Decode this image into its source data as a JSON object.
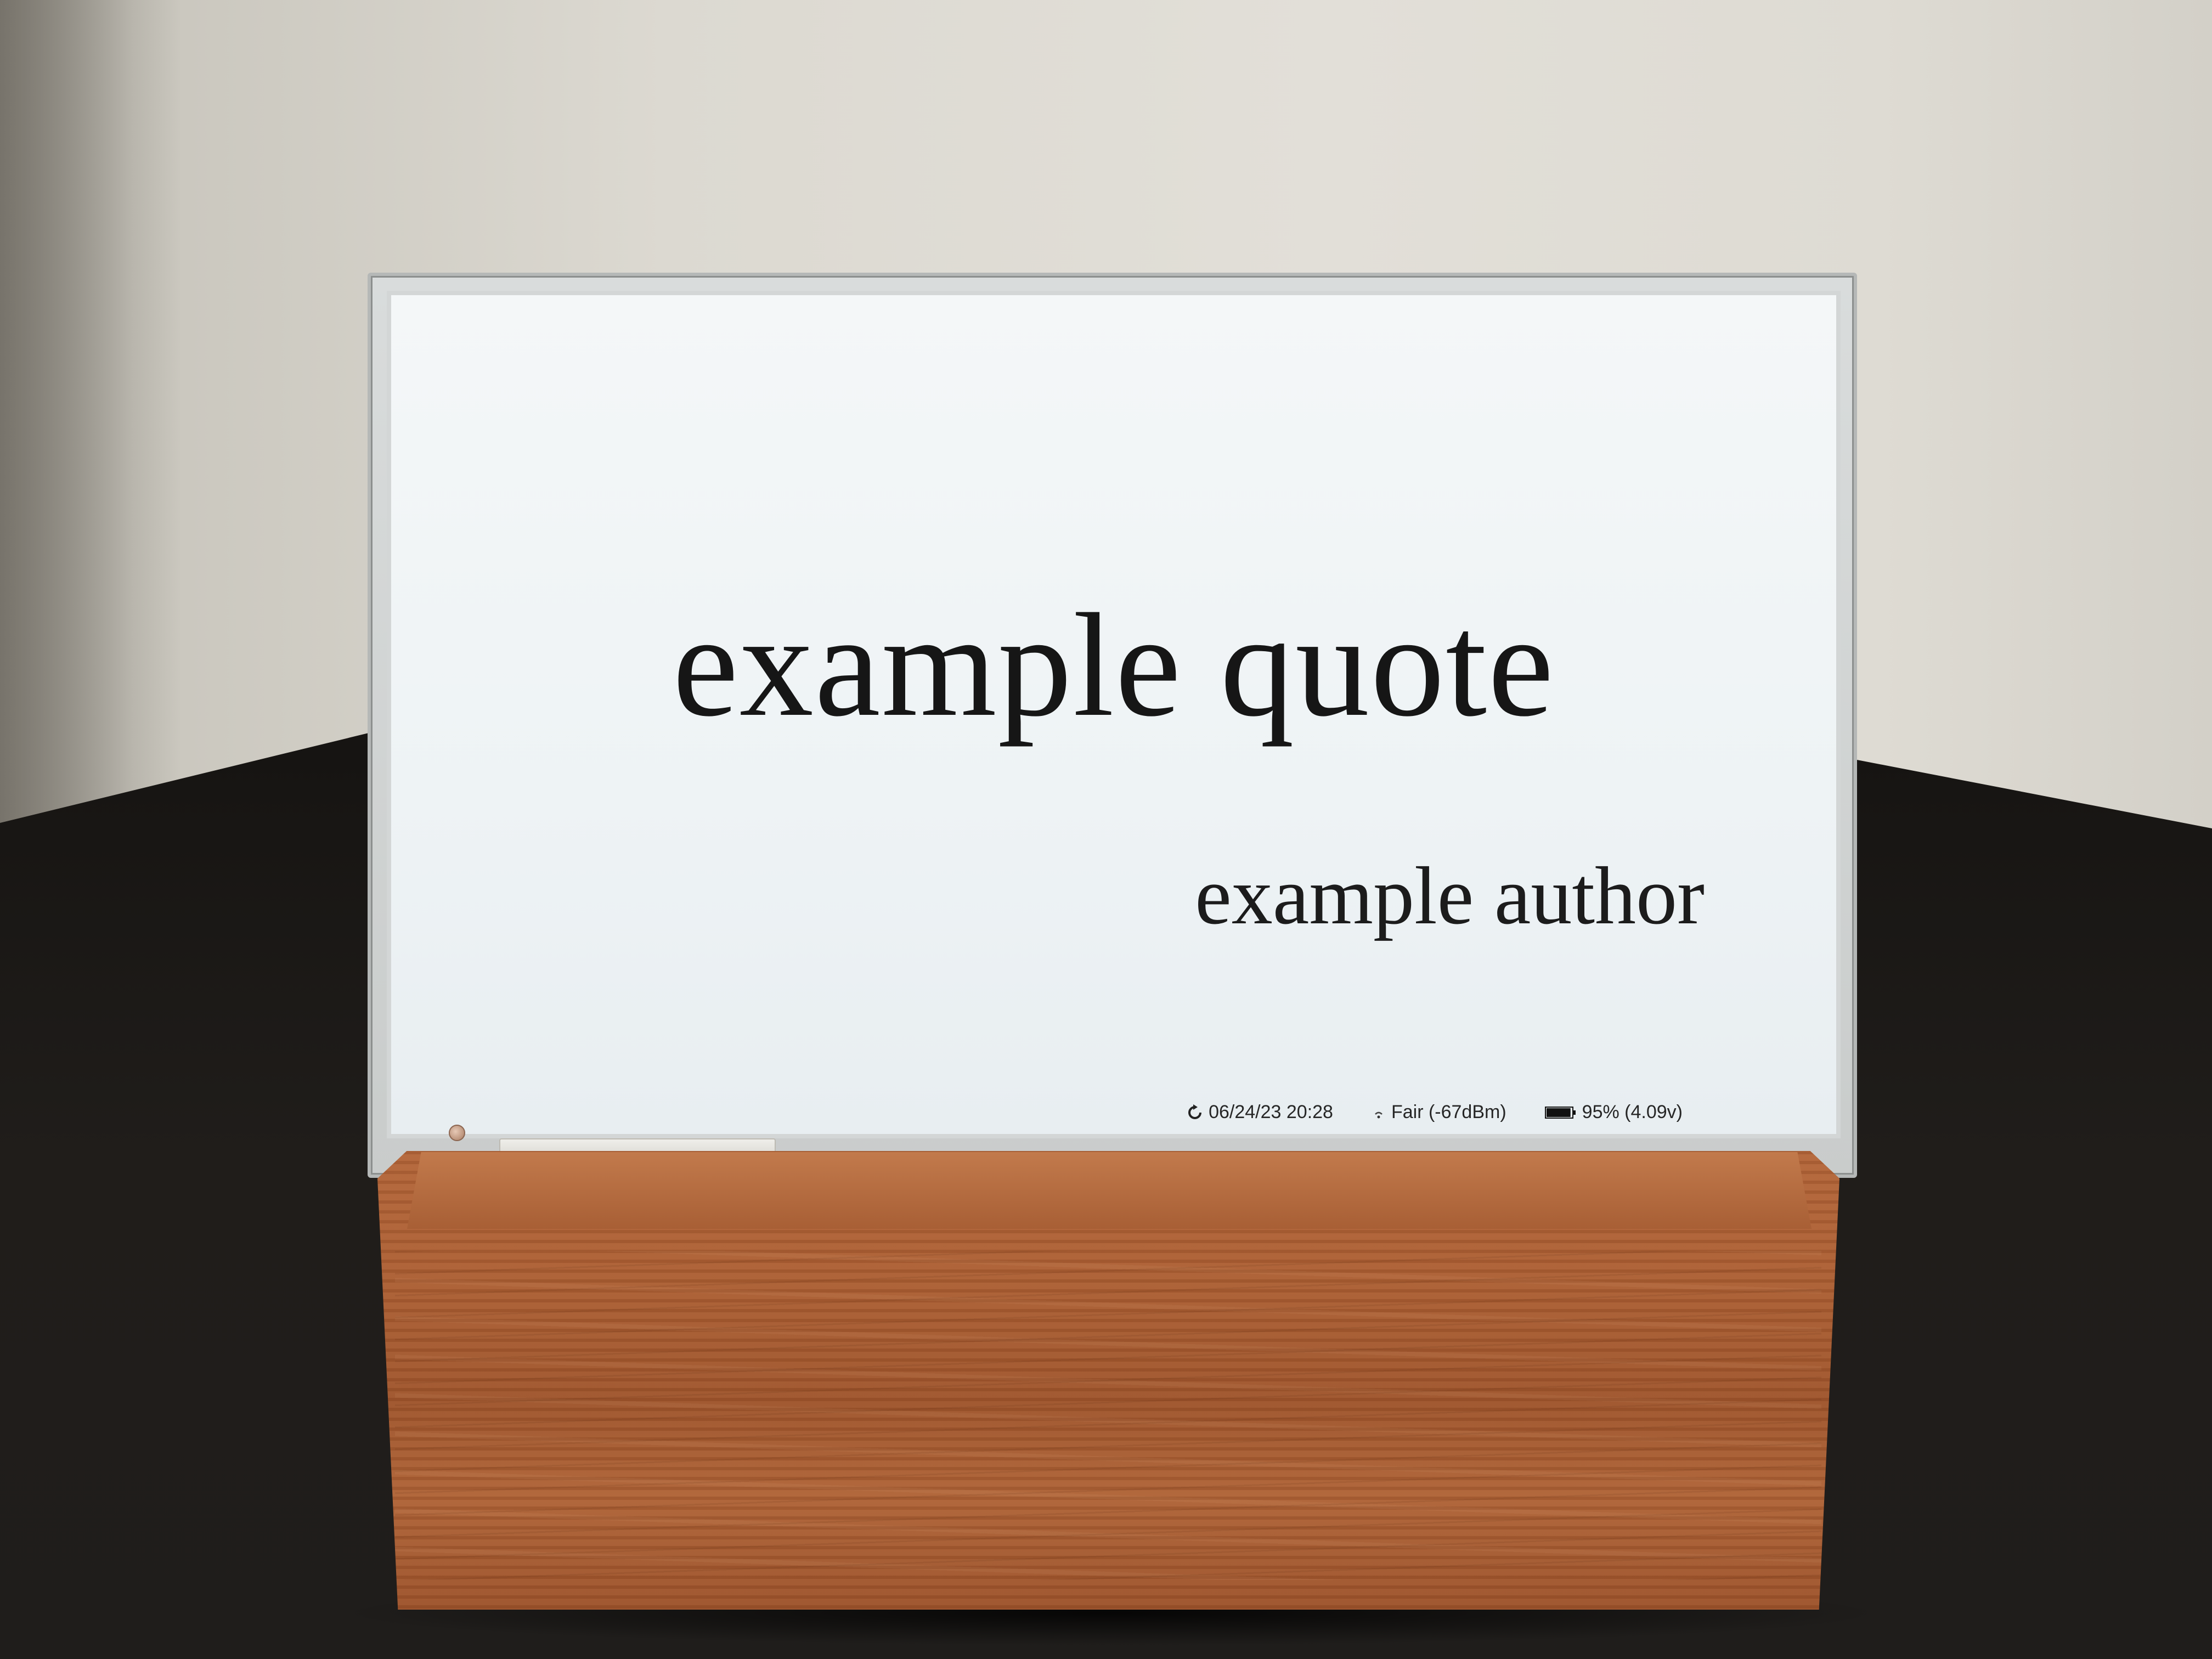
{
  "scene": {
    "description_free": true
  },
  "display": {
    "quote": "example quote",
    "author": "example author",
    "status": {
      "last_refresh": "06/24/23 20:28",
      "wifi": "Fair (-67dBm)",
      "battery": "95% (4.09v)",
      "battery_level_fraction": 0.95,
      "icons": {
        "refresh": "refresh-icon",
        "wifi": "wifi-icon",
        "battery": "battery-icon"
      }
    }
  },
  "colors": {
    "screen": "#eef3f5",
    "text": "#161616",
    "wood": "#a95d33",
    "desk": "#161412",
    "wall": "#dedbd3"
  }
}
